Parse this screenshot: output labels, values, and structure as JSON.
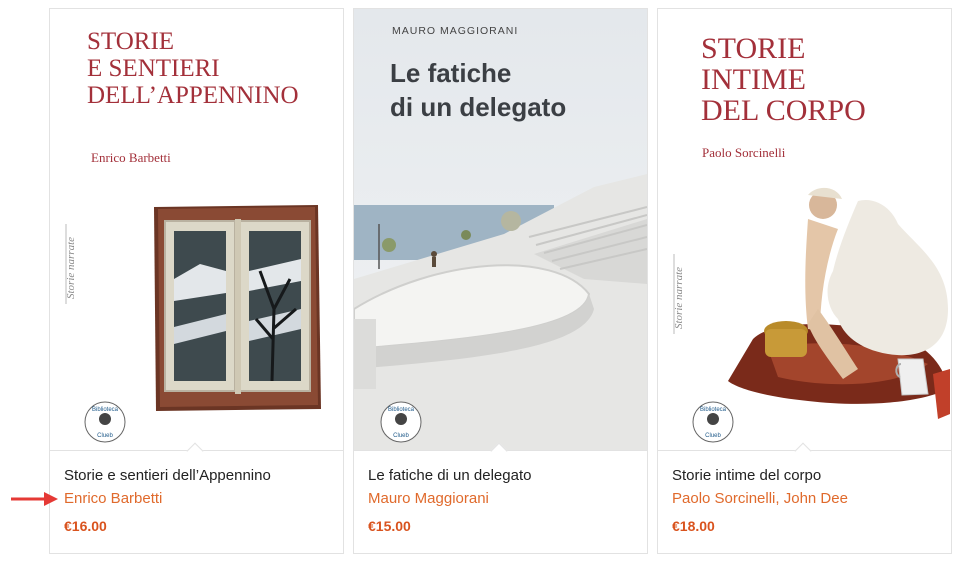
{
  "colors": {
    "accent": "#e06a2c",
    "price": "#d9531e",
    "cover_title": "#a3303a",
    "pointer_arrow": "#e53935"
  },
  "products": [
    {
      "cover": {
        "title_lines": [
          "STORIE",
          "E SENTIERI",
          "DELL’APPENNINO"
        ],
        "author": "Enrico Barbetti",
        "series": "Storie narrate",
        "logo_lines": [
          "Biblioteca",
          "Clueb"
        ]
      },
      "title": "Storie e sentieri dell’Appennino",
      "author": "Enrico Barbetti",
      "price": "€16.00"
    },
    {
      "cover": {
        "author": "MAURO MAGGIORANI",
        "title_lines": [
          "Le fatiche",
          "di un delegato"
        ],
        "logo_lines": [
          "Biblioteca",
          "Clueb"
        ]
      },
      "title": "Le fatiche di un delegato",
      "author": "Mauro Maggiorani",
      "price": "€15.00"
    },
    {
      "cover": {
        "title_lines": [
          "STORIE",
          "INTIME",
          "DEL CORPO"
        ],
        "author": "Paolo Sorcinelli",
        "series": "Storie narrate",
        "logo_lines": [
          "Biblioteca",
          "Clueb"
        ]
      },
      "title": "Storie intime del corpo",
      "author": "Paolo Sorcinelli, John Dee",
      "price": "€18.00"
    }
  ]
}
